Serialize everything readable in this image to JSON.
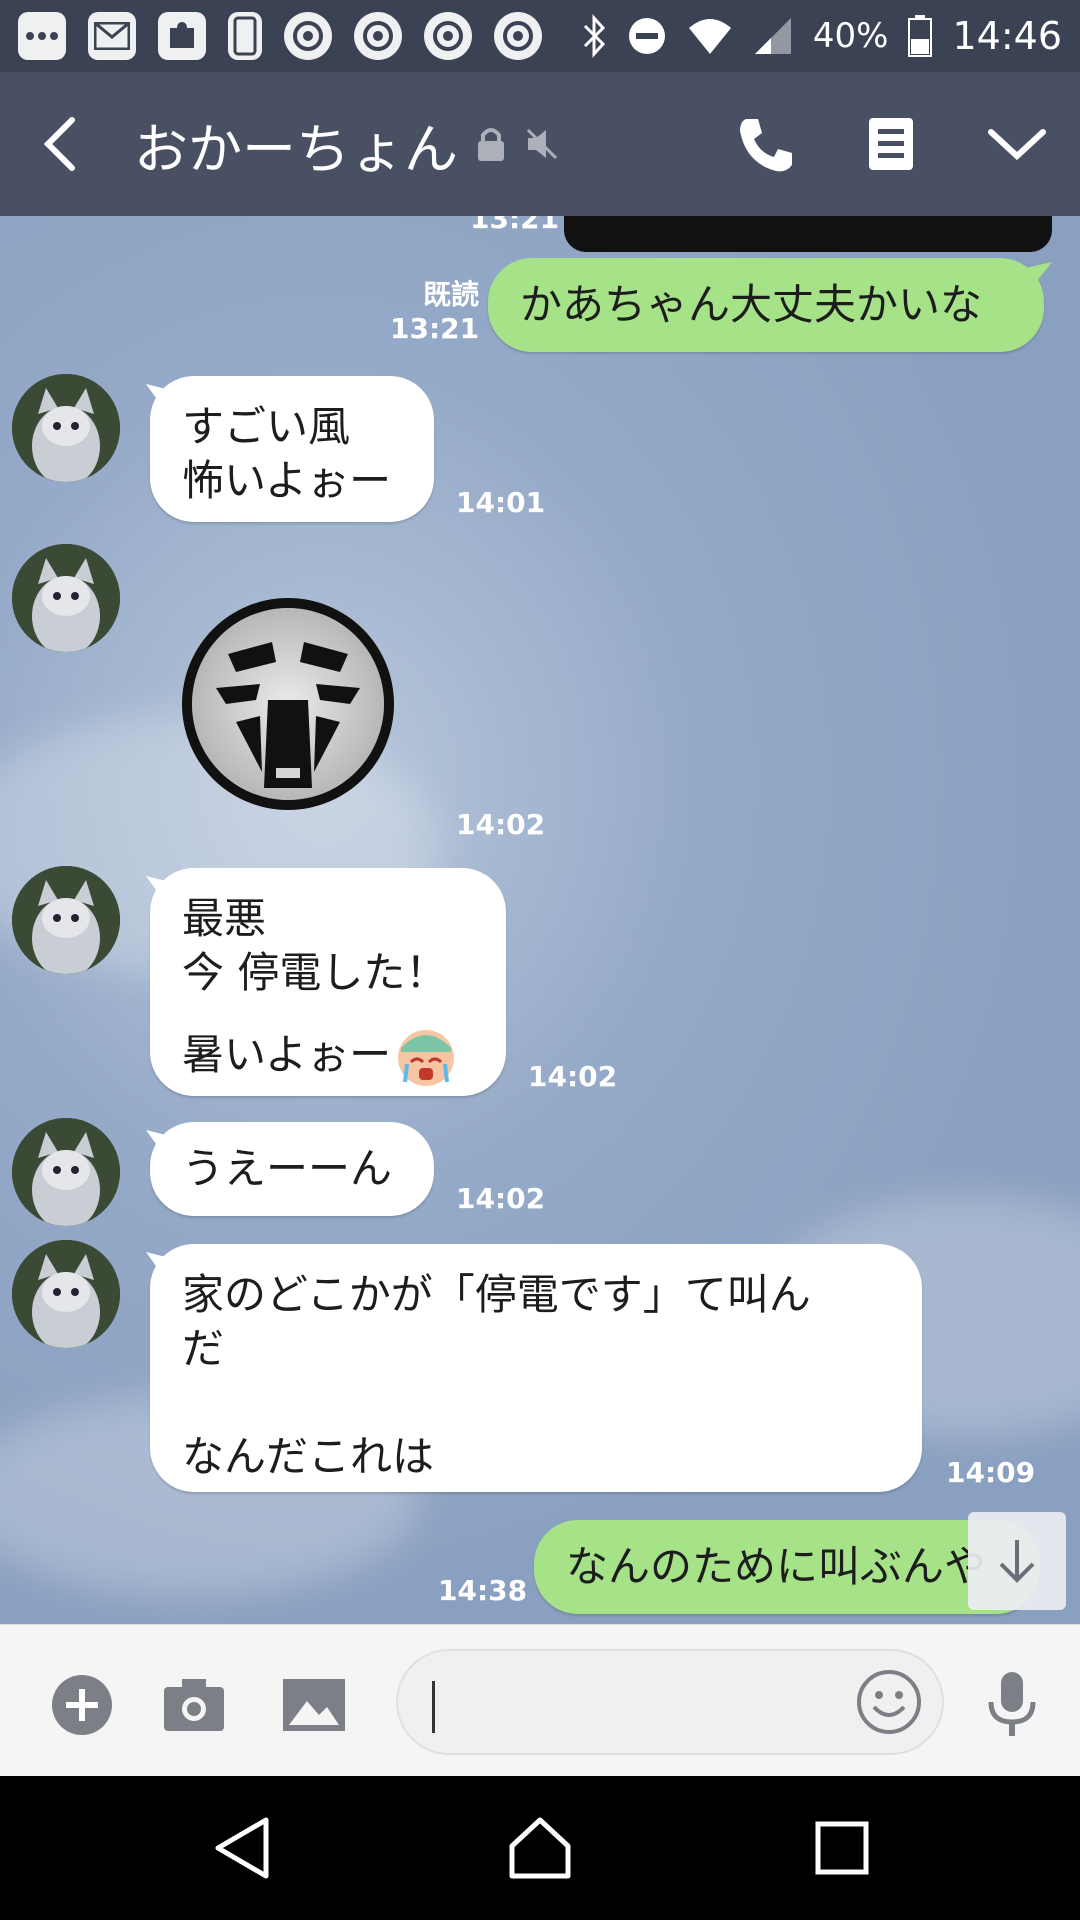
{
  "status_bar": {
    "battery": "40%",
    "time": "14:46"
  },
  "header": {
    "contact_name": "おかーちょん"
  },
  "messages": [
    {
      "dir": "out",
      "text": "かあちゃん大丈夫かいな",
      "read_label": "既読",
      "time": "13:21"
    },
    {
      "dir": "in",
      "lines": [
        "すごい風",
        "怖いよぉー"
      ],
      "time": "14:01"
    },
    {
      "dir": "in",
      "type": "sticker",
      "sticker": "screaming-face-sticker",
      "time": "14:02"
    },
    {
      "dir": "in",
      "lines": [
        "最悪",
        "今 停電した！",
        "暑いよぉー"
      ],
      "time": "14:02"
    },
    {
      "dir": "in",
      "lines": [
        "うえーーん"
      ],
      "time": "14:02"
    },
    {
      "dir": "in",
      "lines": [
        "家のどこかが「停電です」て叫ん",
        "だ",
        "なんだこれは"
      ],
      "time": "14:09"
    },
    {
      "dir": "out",
      "text": "なんのために叫ぶんや",
      "time": "14:38"
    }
  ],
  "top_clip_time": "13:21",
  "colors": {
    "header_bg": "#4a5064",
    "status_bg": "#3b4254",
    "chat_bg": "#8da3c3",
    "out_bubble": "#a6e388",
    "in_bubble": "#ffffff"
  },
  "icons": {
    "status": [
      "more-icon",
      "au-mail-icon",
      "app-icon",
      "phone-icon",
      "chrome-icon",
      "chrome-icon",
      "chrome-icon",
      "chrome-icon",
      "bluetooth-icon",
      "dnd-icon",
      "wifi-icon",
      "signal-icon",
      "battery-icon"
    ],
    "header": [
      "back-icon",
      "lock-icon",
      "mute-icon",
      "call-icon",
      "notes-icon",
      "dropdown-icon"
    ],
    "composer": [
      "add-icon",
      "camera-icon",
      "gallery-icon",
      "emoji-icon",
      "mic-icon"
    ],
    "nav": [
      "nav-back-icon",
      "nav-home-icon",
      "nav-recents-icon"
    ]
  }
}
